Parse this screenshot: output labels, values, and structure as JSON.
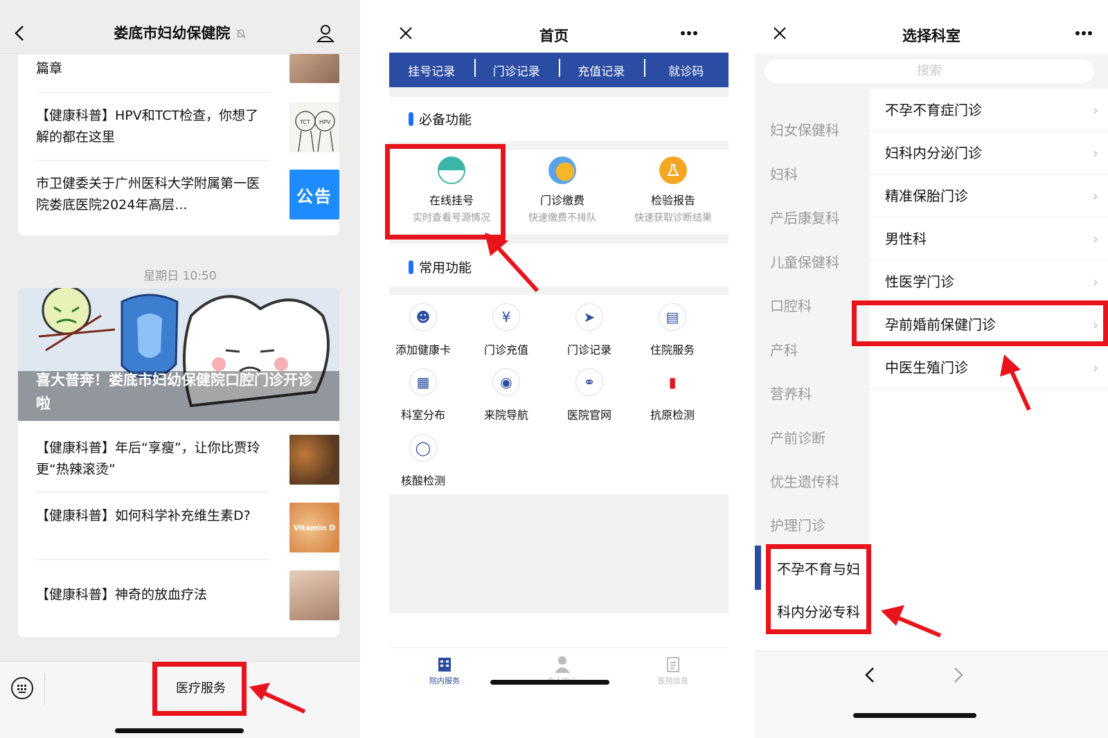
{
  "screen1": {
    "title": "娄底市妇幼保健院",
    "partial_top_text": "篇章",
    "articles_top": [
      "【健康科普】HPV和TCT检查，你想了解的都在这里",
      "市卫健委关于广州医科大学附属第一医院娄底医院2024年高层..."
    ],
    "notice_badge": "公告",
    "tct_label": "TCT",
    "hpv_label": "HPV",
    "timestamp": "星期日 10:50",
    "banner_title": "喜大普奔！娄底市妇幼保健院口腔门诊开诊啦",
    "articles_bottom": [
      "【健康科普】年后“享瘦”，让你比贾玲更“热辣滚烫”",
      "【健康科普】如何科学补充维生素D?",
      "【健康科普】神奇的放血疗法"
    ],
    "vitamin_label": "Vitamin D",
    "menu_label": "医疗服务"
  },
  "screen2": {
    "title": "首页",
    "tabs": [
      "挂号记录",
      "门诊记录",
      "充值记录",
      "就诊码"
    ],
    "essential_title": "必备功能",
    "essential": [
      {
        "label": "在线挂号",
        "sub": "实时查看号源情况"
      },
      {
        "label": "门诊缴费",
        "sub": "快速缴费不排队"
      },
      {
        "label": "检验报告",
        "sub": "快速获取诊断结果"
      }
    ],
    "common_title": "常用功能",
    "common": [
      "添加健康卡",
      "门诊充值",
      "门诊记录",
      "住院服务",
      "科室分布",
      "来院导航",
      "医院官网",
      "抗原检测",
      "核酸检测"
    ],
    "footer": [
      "院内服务",
      "个人中心",
      "医院信息"
    ],
    "colors": {
      "accent": "#2b4ca3",
      "highlight": "#e8141b"
    }
  },
  "screen3": {
    "title": "选择科室",
    "search_placeholder": "搜索",
    "departments": [
      "妇女保健科",
      "妇科",
      "产后康复科",
      "儿童保健科",
      "口腔科",
      "产科",
      "营养科",
      "产前诊断",
      "优生遗传科",
      "护理门诊"
    ],
    "selected_dept_line1": "不孕不育与妇",
    "selected_dept_line2": "科内分泌专科",
    "clinics": [
      "不孕不育症门诊",
      "妇科内分泌门诊",
      "精准保胎门诊",
      "男性科",
      "性医学门诊",
      "孕前婚前保健门诊",
      "中医生殖门诊"
    ]
  }
}
